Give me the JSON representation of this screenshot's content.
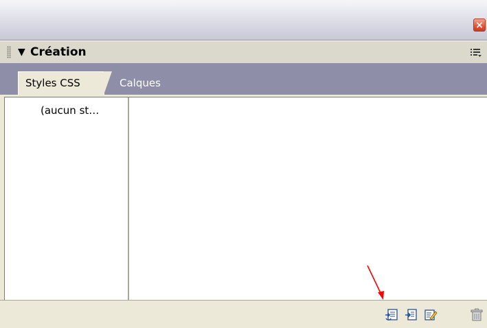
{
  "titlebar": {
    "close_label": "×"
  },
  "panel": {
    "title": "Création",
    "collapse_glyph": "▼"
  },
  "tabs": [
    {
      "label": "Styles CSS",
      "active": true
    },
    {
      "label": "Calques",
      "active": false
    }
  ],
  "tree": {
    "items": [
      {
        "label": "(aucun st…"
      }
    ]
  },
  "toolbar": {
    "buttons": [
      {
        "icon": "attach-stylesheet-icon"
      },
      {
        "icon": "new-css-rule-icon"
      },
      {
        "icon": "edit-style-icon"
      },
      {
        "icon": "delete-icon"
      }
    ]
  },
  "colors": {
    "annotation_arrow": "#ff0000",
    "close_button": "#e0553a"
  }
}
